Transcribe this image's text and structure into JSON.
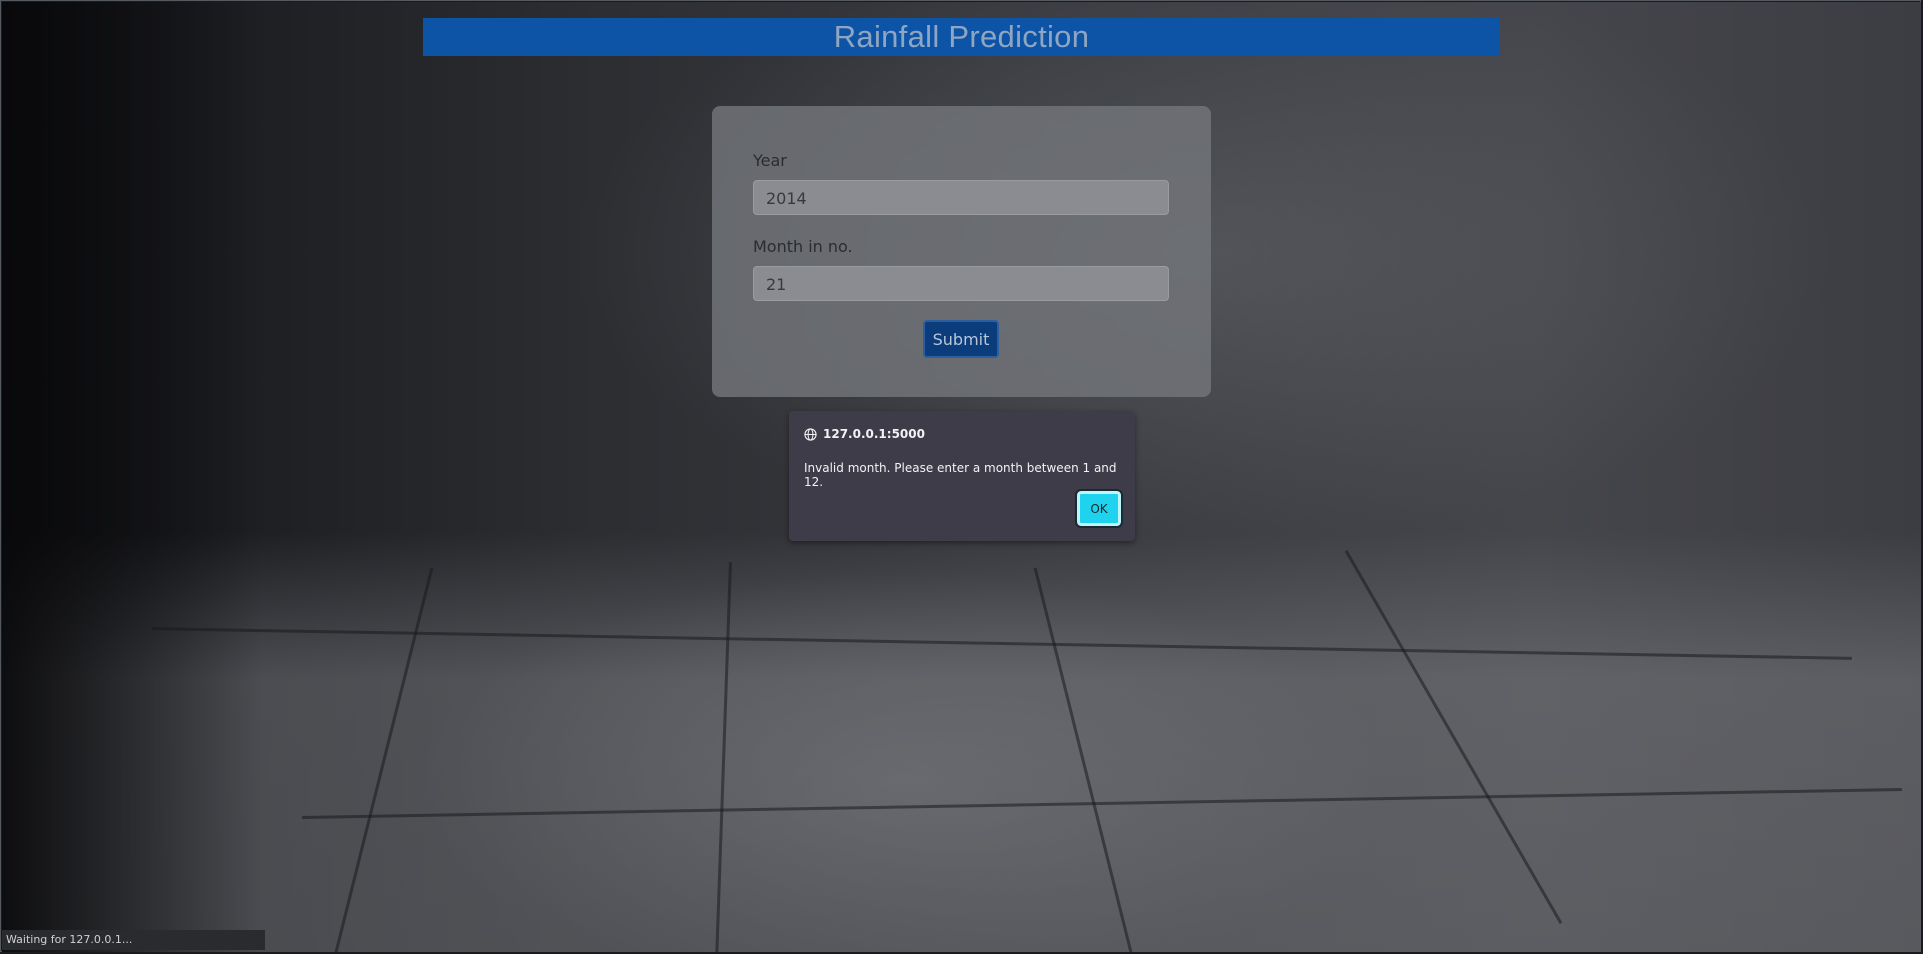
{
  "page": {
    "title": "Rainfall Prediction"
  },
  "form": {
    "year_label": "Year",
    "year_value": "2014",
    "month_label": "Month in no.",
    "month_value": "21",
    "submit_label": "Submit"
  },
  "alert": {
    "origin": "127.0.0.1:5000",
    "message": "Invalid month. Please enter a month between 1 and 12.",
    "ok_label": "OK",
    "origin_icon": "globe-icon"
  },
  "status_bar": {
    "text": "Waiting for 127.0.0.1..."
  },
  "colors": {
    "title_bar": "#0d54a6",
    "submit_button": "#0b3d7c",
    "alert_background": "#3f3c49",
    "ok_button": "#1fd3ee"
  }
}
